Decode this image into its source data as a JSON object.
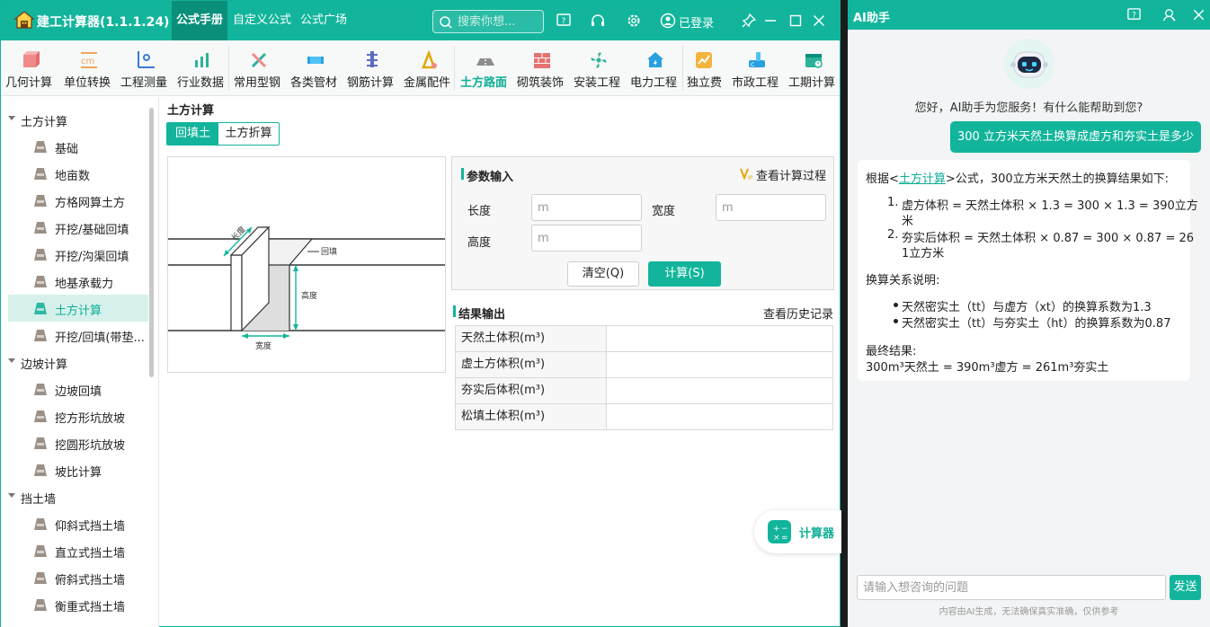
{
  "app": {
    "title": "建工计算器(1.1.1.24)",
    "nav": [
      "公式手册",
      "自定义公式",
      "公式广场"
    ],
    "search_placeholder": "搜索你想...",
    "login_label": "已登录"
  },
  "toolbar": [
    {
      "label": "几何计算",
      "icon": "cube-icon",
      "color": "#f08a8a"
    },
    {
      "label": "单位转换",
      "icon": "unit-cm-icon",
      "color": "#f2a65a"
    },
    {
      "label": "工程测量",
      "icon": "measure-icon",
      "color": "#3a7bd5"
    },
    {
      "label": "行业数据",
      "icon": "bar-chart-icon",
      "color": "#2bb39a"
    },
    {
      "label": "常用型钢",
      "icon": "wrench-icon",
      "color": "#2bb39a"
    },
    {
      "label": "各类管材",
      "icon": "pipe-icon",
      "color": "#4fc3f7"
    },
    {
      "label": "钢筋计算",
      "icon": "rebar-icon",
      "color": "#5c6bc0"
    },
    {
      "label": "金属配件",
      "icon": "metal-icon",
      "color": "#e0a800"
    },
    {
      "label": "土方路面",
      "icon": "road-icon",
      "color": "#8c8c8c"
    },
    {
      "label": "砌筑装饰",
      "icon": "brick-icon",
      "color": "#e57373"
    },
    {
      "label": "安装工程",
      "icon": "fan-icon",
      "color": "#2bb39a"
    },
    {
      "label": "电力工程",
      "icon": "house-power-icon",
      "color": "#29a0e0"
    },
    {
      "label": "独立费",
      "icon": "fee-chart-icon",
      "color": "#f2b43c"
    },
    {
      "label": "市政工程",
      "icon": "municipal-icon",
      "color": "#29a0e0"
    },
    {
      "label": "工期计算",
      "icon": "calendar-icon",
      "color": "#2bb39a"
    }
  ],
  "toolbar_active": "土方路面",
  "sidebar": {
    "groups": [
      {
        "label": "土方计算",
        "items": [
          "基础",
          "地亩数",
          "方格网算土方",
          "开挖/基础回填",
          "开挖/沟渠回填",
          "地基承载力",
          "土方计算",
          "开挖/回填(带垫..."
        ]
      },
      {
        "label": "边坡计算",
        "items": [
          "边坡回填",
          "挖方形坑放坡",
          "挖圆形坑放坡",
          "坡比计算"
        ]
      },
      {
        "label": "挡土墙",
        "items": [
          "仰斜式挡土墙",
          "直立式挡土墙",
          "俯斜式挡土墙",
          "衡重式挡土墙"
        ]
      }
    ],
    "selected": "土方计算"
  },
  "content": {
    "title": "土方计算",
    "tabs": [
      "回填土",
      "土方折算"
    ],
    "diagram_labels": {
      "length": "长度",
      "backfill": "回填",
      "height": "高度",
      "width": "宽度"
    },
    "params": {
      "title": "参数输入",
      "process_link": "查看计算过程",
      "fields": [
        {
          "label": "长度",
          "placeholder": "m"
        },
        {
          "label": "宽度",
          "placeholder": "m"
        },
        {
          "label": "高度",
          "placeholder": "m"
        }
      ],
      "clear_button": "清空(Q)",
      "calc_button": "计算(S)"
    },
    "results": {
      "title": "结果输出",
      "history_link": "查看历史记录",
      "rows": [
        "天然土体积(m³)",
        "虚土方体积(m³)",
        "夯实后体积(m³)",
        "松填土体积(m³)"
      ]
    },
    "float_calc_label": "计算器"
  },
  "ai": {
    "title": "AI助手",
    "greeting": "您好，AI助手为您服务！有什么能帮助到您?",
    "user_message": "300 立方米天然土换算成虚方和夯实土是多少",
    "reply": {
      "intro_pre": "根据<",
      "intro_link": "土方计算",
      "intro_post": ">公式，300立方米天然土的换算结果如下:",
      "steps": [
        [
          "1.",
          "虚方体积 = 天然土体积 × 1.3 = 300 × 1.3 = 390立方",
          "米"
        ],
        [
          "2.",
          "夯实后体积 = 天然土体积 × 0.87 = 300 × 0.87 = 26",
          "1立方米"
        ]
      ],
      "note_title": "换算关系说明:",
      "notes": [
        "天然密实土（tt）与虚方（xt）的换算系数为1.3",
        "天然密实土（tt）与夯实土（ht）的换算系数为0.87"
      ],
      "final_title": "最终结果:",
      "final_text": "300m³天然土 = 390m³虚方 = 261m³夯实土"
    },
    "input_placeholder": "请输入想咨询的问题",
    "send_label": "发送",
    "disclaimer": "内容由AI生成，无法确保真实准确，仅供参考"
  }
}
